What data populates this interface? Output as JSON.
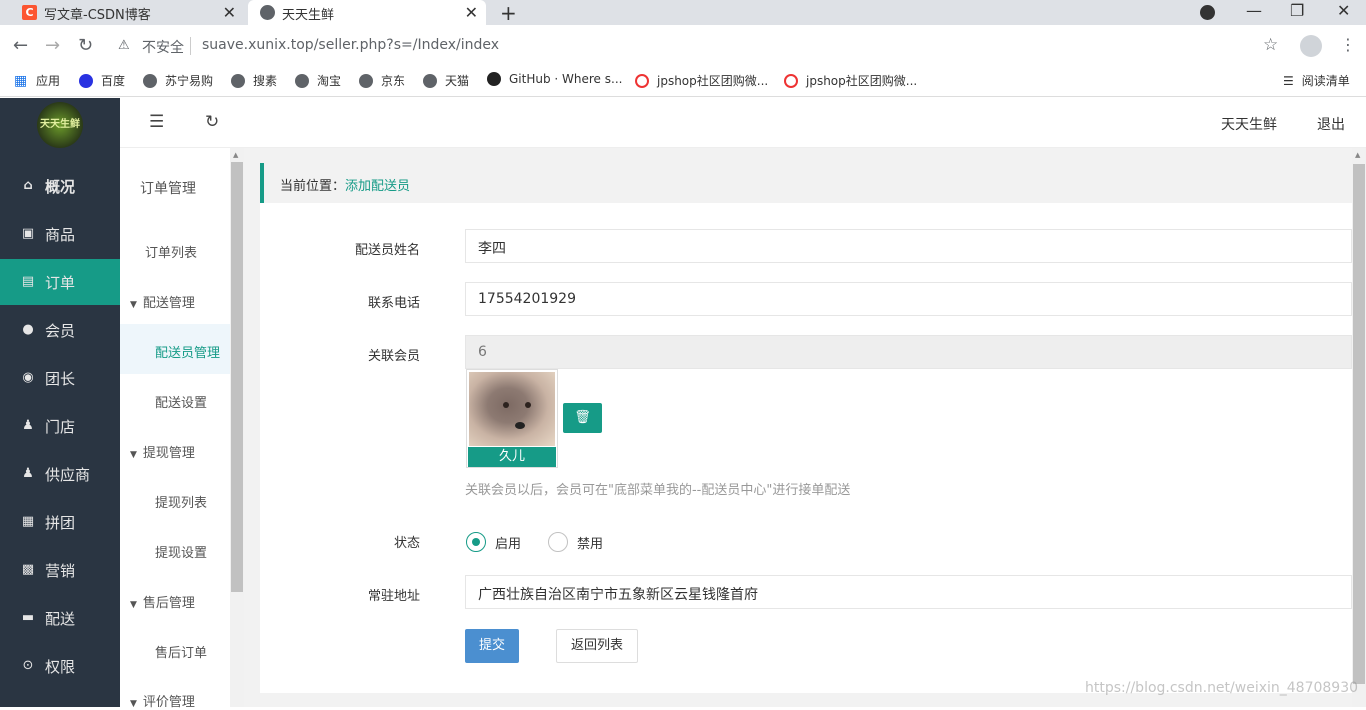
{
  "browser": {
    "tabs": [
      {
        "title": "写文章-CSDN博客",
        "favicon_letter": "C"
      },
      {
        "title": "天天生鲜"
      }
    ],
    "new_tab": "+",
    "window_controls": {
      "minimize": "—",
      "maximize": "❐",
      "close": "✕"
    },
    "nav": {
      "back": "←",
      "forward": "→",
      "reload": "↻"
    },
    "security_label": "不安全",
    "url": "suave.xunix.top/seller.php?s=/Index/index",
    "bookmarks": [
      "应用",
      "百度",
      "苏宁易购",
      "搜素",
      "淘宝",
      "京东",
      "天猫",
      "GitHub · Where s...",
      "jpshop社区团购微...",
      "jpshop社区团购微..."
    ],
    "reading_list": "阅读清单"
  },
  "app": {
    "logo_text": "天天生鲜",
    "sidebar": [
      {
        "label": "概况",
        "icon": "home-icon"
      },
      {
        "label": "商品",
        "icon": "goods-icon"
      },
      {
        "label": "订单",
        "icon": "order-icon"
      },
      {
        "label": "会员",
        "icon": "member-icon"
      },
      {
        "label": "团长",
        "icon": "leader-icon"
      },
      {
        "label": "门店",
        "icon": "store-icon"
      },
      {
        "label": "供应商",
        "icon": "supplier-icon"
      },
      {
        "label": "拼团",
        "icon": "group-icon"
      },
      {
        "label": "营销",
        "icon": "gift-icon"
      },
      {
        "label": "配送",
        "icon": "truck-icon"
      },
      {
        "label": "权限",
        "icon": "lock-icon"
      }
    ],
    "topbar": {
      "shop_name": "天天生鲜",
      "logout": "退出"
    },
    "submenu": {
      "title": "订单管理",
      "items": [
        {
          "label": "订单列表"
        },
        {
          "label": "配送管理"
        },
        {
          "label": "配送员管理"
        },
        {
          "label": "配送设置"
        },
        {
          "label": "提现管理"
        },
        {
          "label": "提现列表"
        },
        {
          "label": "提现设置"
        },
        {
          "label": "售后管理"
        },
        {
          "label": "售后订单"
        },
        {
          "label": "评价管理"
        }
      ]
    },
    "breadcrumb": {
      "prefix": "当前位置：",
      "current": "添加配送员"
    },
    "form": {
      "name_label": "配送员姓名",
      "name_value": "李四",
      "phone_label": "联系电话",
      "phone_value": "17554201929",
      "member_label": "关联会员",
      "member_value": "6",
      "member_name": "久儿",
      "hint": "关联会员以后，会员可在\"底部菜单我的--配送员中心\"进行接单配送",
      "status_label": "状态",
      "status_on": "启用",
      "status_off": "禁用",
      "status_selected": "启用",
      "address_label": "常驻地址",
      "address_value": "广西壮族自治区南宁市五象新区云星钱隆首府",
      "submit": "提交",
      "back": "返回列表"
    },
    "watermark": "https://blog.csdn.net/weixin_48708930",
    "colors": {
      "accent": "#169b87",
      "sidebar_bg": "#2a3542",
      "submit_btn": "#4b8fd0"
    }
  }
}
